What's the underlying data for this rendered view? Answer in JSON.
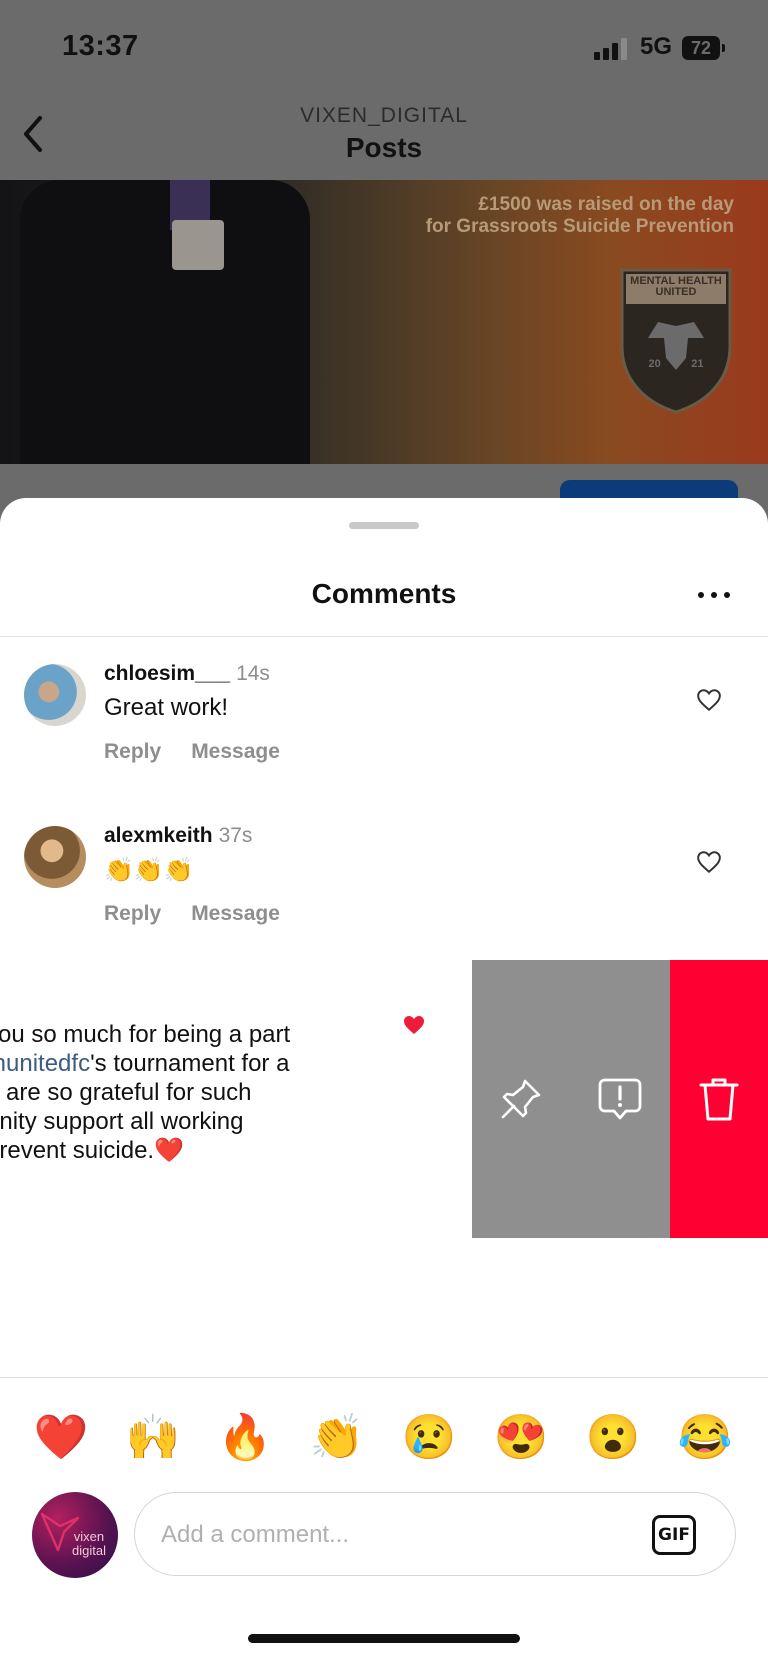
{
  "status_bar": {
    "time": "13:37",
    "network": "5G",
    "battery": "72"
  },
  "header": {
    "account": "VIXEN_DIGITAL",
    "title": "Posts"
  },
  "post": {
    "caption_line1": "£1500 was raised on the day",
    "caption_line2": "for Grassroots Suicide Prevention",
    "crest_text": "MENTAL HEALTH UNITED",
    "crest_year_left": "20",
    "crest_year_right": "21"
  },
  "comments_sheet": {
    "title": "Comments",
    "comments": [
      {
        "user": "chloesim___",
        "time": "14s",
        "text": "Great work!",
        "reply": "Reply",
        "message": "Message"
      },
      {
        "user": "alexmkeith",
        "time": "37s",
        "text": "👏👏👏",
        "reply": "Reply",
        "message": "Message"
      }
    ],
    "swiped_comment": {
      "lines": [
        "you so much for being a part",
        "'s tournament for a",
        "e are so grateful for such",
        "unity support all working",
        " prevent suicide.❤️"
      ],
      "mention": "thunitedfc",
      "liked": true
    },
    "actions": {
      "pin_icon": "pin-icon",
      "report_icon": "report-icon",
      "delete_icon": "trash-icon",
      "delete_color": "#ff0033",
      "neutral_color": "#8f8f8f"
    }
  },
  "emoji_bar": [
    "❤️",
    "🙌",
    "🔥",
    "👏",
    "😢",
    "😍",
    "😮",
    "😂"
  ],
  "composer": {
    "placeholder": "Add a comment...",
    "gif_label": "GIF",
    "avatar_text_1": "vixen",
    "avatar_text_2": "digital"
  },
  "colors": {
    "like_red": "#ed1c3b",
    "mention_blue": "#3d5a80"
  }
}
